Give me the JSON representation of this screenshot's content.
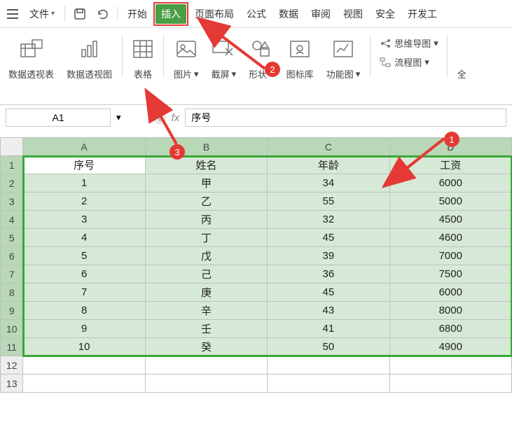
{
  "menubar": {
    "file": "文件",
    "tabs": [
      "开始",
      "插入",
      "页面布局",
      "公式",
      "数据",
      "审阅",
      "视图",
      "安全",
      "开发工"
    ],
    "active_index": 1
  },
  "ribbon": {
    "groups": [
      {
        "label": "数据透视表",
        "icon": "pivot-table-icon"
      },
      {
        "label": "数据透视图",
        "icon": "pivot-chart-icon"
      },
      {
        "label": "表格",
        "icon": "table-icon"
      },
      {
        "label": "图片",
        "icon": "picture-icon",
        "dropdown": true
      },
      {
        "label": "截屏",
        "icon": "screenshot-icon",
        "dropdown": true
      },
      {
        "label": "形状",
        "icon": "shapes-icon",
        "dropdown": true
      },
      {
        "label": "图标库",
        "icon": "icon-lib-icon"
      },
      {
        "label": "功能图",
        "icon": "feature-chart-icon",
        "dropdown": true
      }
    ],
    "stack": [
      {
        "label": "思维导图",
        "icon": "mindmap-icon",
        "dropdown": true
      },
      {
        "label": "流程图",
        "icon": "flowchart-icon",
        "dropdown": true
      }
    ],
    "truncated": "全"
  },
  "formula": {
    "cellref": "A1",
    "fx": "fx",
    "value": "序号"
  },
  "chart_data": {
    "type": "table",
    "columns": [
      "序号",
      "姓名",
      "年龄",
      "工资"
    ],
    "rows": [
      [
        1,
        "甲",
        34,
        6000
      ],
      [
        2,
        "乙",
        55,
        5000
      ],
      [
        3,
        "丙",
        32,
        4500
      ],
      [
        4,
        "丁",
        45,
        4600
      ],
      [
        5,
        "戊",
        39,
        7000
      ],
      [
        6,
        "己",
        36,
        7500
      ],
      [
        7,
        "庚",
        45,
        6000
      ],
      [
        8,
        "辛",
        43,
        8000
      ],
      [
        9,
        "壬",
        41,
        6800
      ],
      [
        10,
        "癸",
        50,
        4900
      ]
    ]
  },
  "sheet": {
    "col_letters": [
      "A",
      "B",
      "C",
      "D"
    ],
    "row_numbers": [
      1,
      2,
      3,
      4,
      5,
      6,
      7,
      8,
      9,
      10,
      11,
      12,
      13
    ],
    "selection": "A1:D11",
    "active_cell": "A1"
  },
  "annotations": {
    "badges": [
      {
        "id": 1
      },
      {
        "id": 2
      },
      {
        "id": 3
      }
    ],
    "colors": {
      "badge": "#e53935",
      "arrow": "#e53935",
      "accent": "#4a9e46",
      "sel_border": "#38a838"
    }
  }
}
